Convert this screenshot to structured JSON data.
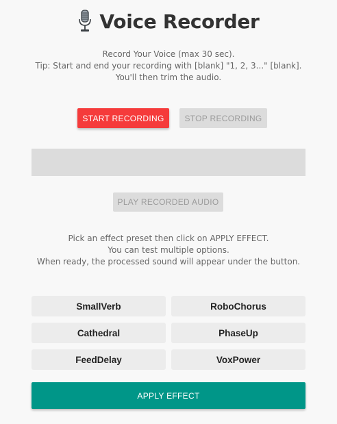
{
  "header": {
    "title": "Voice Recorder",
    "icon": "microphone-icon"
  },
  "intro": {
    "line1": "Record Your Voice (max 30 sec).",
    "line2": "Tip: Start and end your recording with [blank] \"1, 2, 3...\" [blank].",
    "line3": "You'll then trim the audio."
  },
  "controls": {
    "start_label": "START RECORDING",
    "stop_label": "STOP RECORDING",
    "play_label": "PLAY RECORDED AUDIO"
  },
  "instructions": {
    "line1": "Pick an effect preset then click on APPLY EFFECT.",
    "line2": "You can test multiple options.",
    "line3": "When ready, the processed sound will appear under the button."
  },
  "presets": [
    "SmallVerb",
    "RoboChorus",
    "Cathedral",
    "PhaseUp",
    "FeedDelay",
    "VoxPower"
  ],
  "apply_label": "APPLY EFFECT",
  "colors": {
    "start": "#f53b3b",
    "apply": "#009688",
    "disabled": "#dcdcdc",
    "background": "#f8f8f8"
  }
}
